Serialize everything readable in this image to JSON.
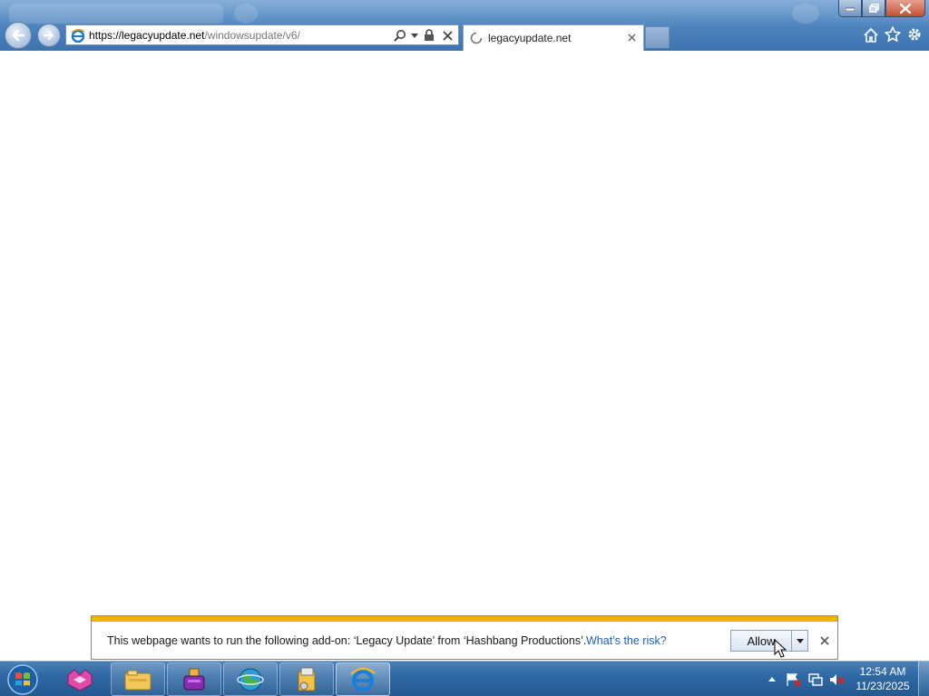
{
  "window": {
    "controls": {
      "minimize_icon": "minimize-icon",
      "restore_icon": "restore-icon",
      "close_icon": "close-icon"
    }
  },
  "address_bar": {
    "url_host": "https://legacyupdate.net",
    "url_path": "/windowsupdate/v6/",
    "icons": [
      "ie-page-icon",
      "search-icon",
      "dropdown-icon",
      "lock-icon",
      "stop-icon"
    ]
  },
  "tab": {
    "title": "legacyupdate.net",
    "loading": true
  },
  "toolbar_right": [
    "home-icon",
    "favorites-star-icon",
    "settings-gear-icon"
  ],
  "notification": {
    "message": "This webpage wants to run the following add-on: ‘Legacy Update’ from ‘Hashbang Productions’.",
    "risk_link": "What’s the risk?",
    "allow_label": "Allow",
    "accent_color": "#f0b400"
  },
  "taskbar": {
    "items": [
      {
        "name": "start-orb",
        "state": "normal"
      },
      {
        "name": "app-pink-icon",
        "state": "pinned"
      },
      {
        "name": "file-explorer-icon",
        "state": "pinned"
      },
      {
        "name": "toaster-app-icon",
        "state": "pinned"
      },
      {
        "name": "globe-app-icon",
        "state": "pinned"
      },
      {
        "name": "install-package-icon",
        "state": "pinned"
      },
      {
        "name": "internet-explorer-icon",
        "state": "active"
      }
    ],
    "tray": [
      "show-hidden-icons-arrow",
      "action-center-flag-icon",
      "network-icon",
      "volume-muted-icon"
    ],
    "clock": {
      "time": "12:54 AM",
      "date": "11/23/2025"
    }
  },
  "colors": {
    "taskbar": "#2f6aa6",
    "link": "#1b5ec1",
    "infobar_accent": "#f0b400"
  }
}
